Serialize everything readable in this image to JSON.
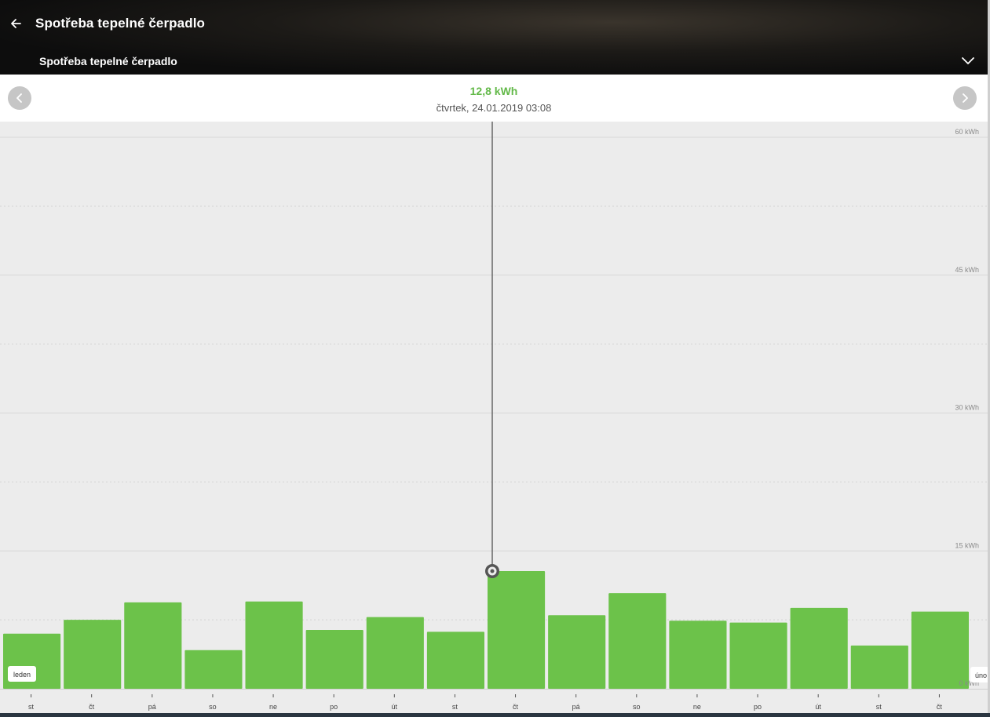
{
  "header": {
    "title": "Spotřeba tepelné čerpadlo",
    "subtitle": "Spotřeba tepelné čerpadlo",
    "back_icon": "arrow-left-icon",
    "dropdown_icon": "chevron-down-icon"
  },
  "readout": {
    "value": "12,8 kWh",
    "date": "čtvrtek, 24.01.2019 03:08",
    "prev_icon": "chevron-left-icon",
    "next_icon": "chevron-right-icon"
  },
  "colors": {
    "bar": "#6cc24a",
    "accent_text": "#63b949",
    "cursor_line": "#666666"
  },
  "chart_data": {
    "type": "bar",
    "categories": [
      "st",
      "čt",
      "pá",
      "so",
      "ne",
      "po",
      "út",
      "st",
      "čt",
      "pá",
      "so",
      "ne",
      "po",
      "út",
      "st",
      "čt"
    ],
    "values": [
      6.0,
      7.5,
      9.4,
      4.2,
      9.5,
      6.4,
      7.8,
      6.2,
      12.8,
      8.0,
      10.4,
      7.4,
      7.2,
      8.8,
      4.7,
      8.4
    ],
    "ylim": [
      0,
      60
    ],
    "yticks": [
      {
        "value": 0,
        "label": "0  kWh"
      },
      {
        "value": 15,
        "label": "15  kWh"
      },
      {
        "value": 30,
        "label": "30  kWh"
      },
      {
        "value": 45,
        "label": "45  kWh"
      },
      {
        "value": 60,
        "label": "60  kWh"
      }
    ],
    "grid": true,
    "month_labels": {
      "start": "leden",
      "end": "úno"
    },
    "selected_index": 8,
    "selected_value": 12.8
  }
}
